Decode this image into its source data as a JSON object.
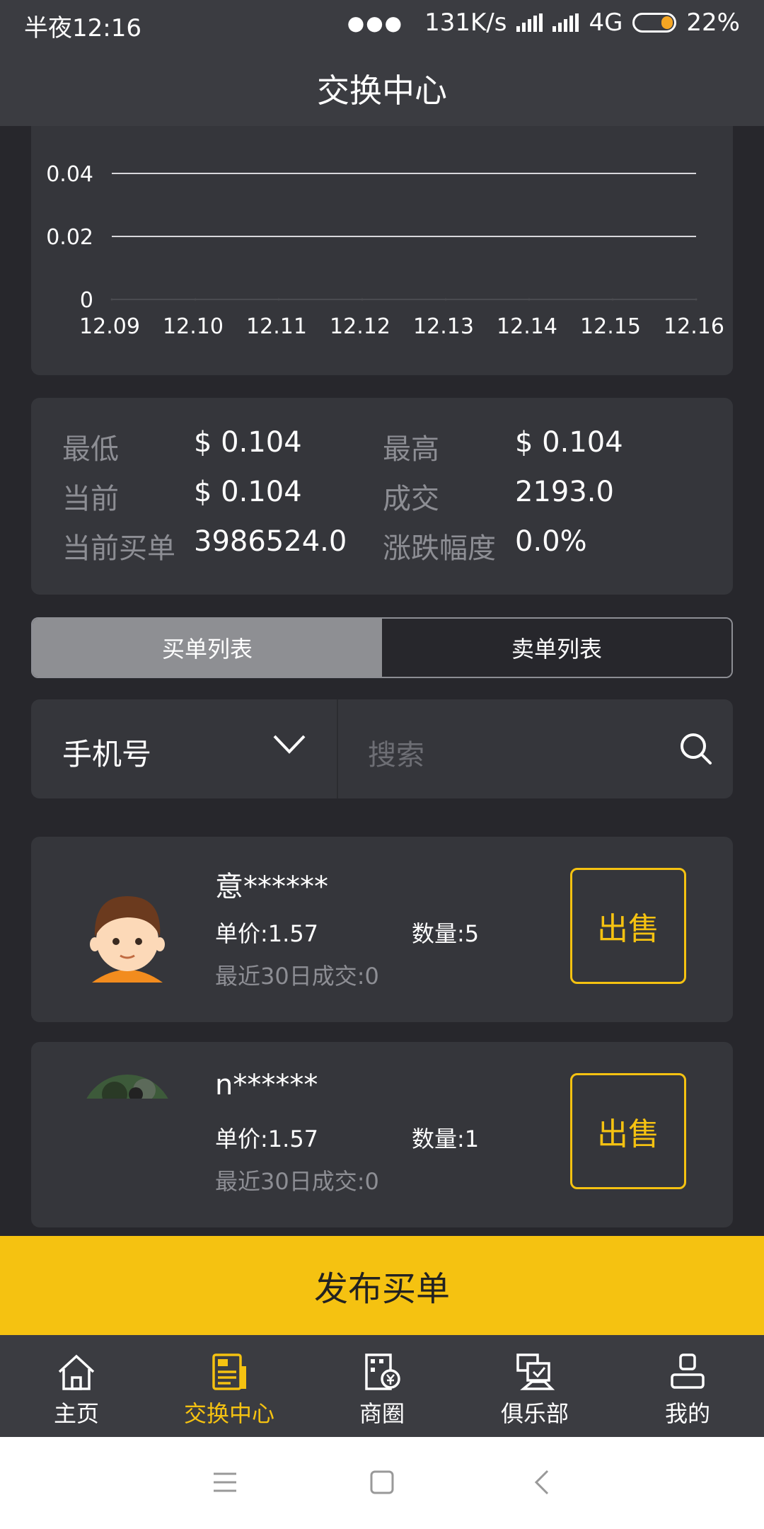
{
  "status_bar": {
    "time": "半夜12:16",
    "speed": "131K/s",
    "network": "4G",
    "battery": "22%"
  },
  "header": {
    "title": "交换中心"
  },
  "chart_data": {
    "type": "line",
    "x": [
      "12.09",
      "12.10",
      "12.11",
      "12.12",
      "12.13",
      "12.14",
      "12.15",
      "12.16"
    ],
    "series": [
      {
        "values": [
          0,
          0,
          0,
          0,
          0,
          0,
          0,
          0
        ]
      }
    ],
    "y_ticks": [
      "0",
      "0.02",
      "0.04"
    ],
    "ylim": [
      0,
      0.04
    ],
    "grid": true
  },
  "stats": {
    "low_label": "最低",
    "low_value": "$ 0.104",
    "high_label": "最高",
    "high_value": "$ 0.104",
    "current_label": "当前",
    "current_value": "$ 0.104",
    "volume_label": "成交",
    "volume_value": "2193.0",
    "buy_orders_label": "当前买单",
    "buy_orders_value": "3986524.0",
    "change_label": "涨跌幅度",
    "change_value": "0.0%"
  },
  "tabs": [
    {
      "label": "买单列表",
      "active": true
    },
    {
      "label": "卖单列表",
      "active": false
    }
  ],
  "search": {
    "filter_label": "手机号",
    "placeholder": "搜索"
  },
  "orders": [
    {
      "name": "意******",
      "price": "单价:1.57",
      "quantity": "数量:5",
      "recent": "最近30日成交:0",
      "action": "出售",
      "avatar": "cartoon-boy"
    },
    {
      "name": "n******",
      "price": "单价:1.57",
      "quantity": "数量:1",
      "recent": "最近30日成交:0",
      "action": "出售",
      "avatar": "photo"
    }
  ],
  "publish_button": "发布买单",
  "bottom_nav": [
    {
      "label": "主页",
      "icon": "home-icon",
      "active": false
    },
    {
      "label": "交换中心",
      "icon": "exchange-icon",
      "active": true
    },
    {
      "label": "商圈",
      "icon": "business-icon",
      "active": false
    },
    {
      "label": "俱乐部",
      "icon": "club-icon",
      "active": false
    },
    {
      "label": "我的",
      "icon": "profile-icon",
      "active": false
    }
  ],
  "colors": {
    "accent": "#f5c211",
    "card": "#35363b",
    "background": "#27272c"
  }
}
